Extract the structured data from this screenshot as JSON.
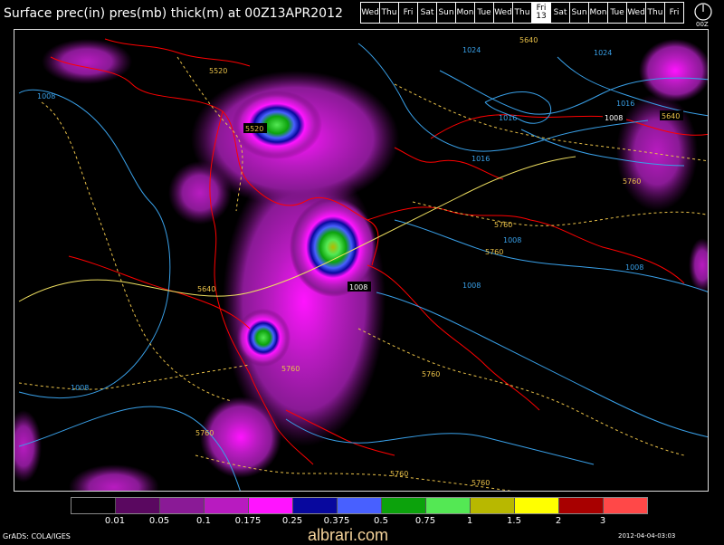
{
  "title": "Surface prec(in) pres(mb) thick(m) at 00Z13APR2012",
  "days": [
    {
      "label": "Wed"
    },
    {
      "label": "Thu"
    },
    {
      "label": "Fri"
    },
    {
      "label": "Sat"
    },
    {
      "label": "Sun"
    },
    {
      "label": "Mon"
    },
    {
      "label": "Tue"
    },
    {
      "label": "Wed"
    },
    {
      "label": "Thu"
    },
    {
      "label": "Fri",
      "sub": "13",
      "selected": true
    },
    {
      "label": "Sat"
    },
    {
      "label": "Sun"
    },
    {
      "label": "Mon"
    },
    {
      "label": "Tue"
    },
    {
      "label": "Wed"
    },
    {
      "label": "Thu"
    },
    {
      "label": "Fri"
    }
  ],
  "clock_label": "00Z",
  "map_labels": {
    "pressure": [
      "1024",
      "1008",
      "1016",
      "1016",
      "1008",
      "1008",
      "1008",
      "1008",
      "1008",
      "1024",
      "1016",
      "1008"
    ],
    "thickness": [
      "5640",
      "5520",
      "5520",
      "5760",
      "5760",
      "5640",
      "5760",
      "5760",
      "5760",
      "5760",
      "5760",
      "5640",
      "5760"
    ]
  },
  "legend": {
    "colors": [
      "#000000",
      "#5a0860",
      "#8a1a96",
      "#b81bc0",
      "#ff14ff",
      "#08089e",
      "#4860ff",
      "#0ca20c",
      "#54e854",
      "#b8b800",
      "#ffff00",
      "#a80000",
      "#ff4848"
    ],
    "labels": [
      "0.01",
      "0.05",
      "0.1",
      "0.175",
      "0.25",
      "0.375",
      "0.5",
      "0.75",
      "1",
      "1.5",
      "2",
      "3"
    ]
  },
  "credit": "GrADS: COLA/IGES",
  "stamp": "2012-04-04-03:03",
  "site": "albrari.com",
  "colors": {
    "coast": "#ff0000",
    "isobar": "#39a0e8",
    "thickness": "#e8c048"
  }
}
